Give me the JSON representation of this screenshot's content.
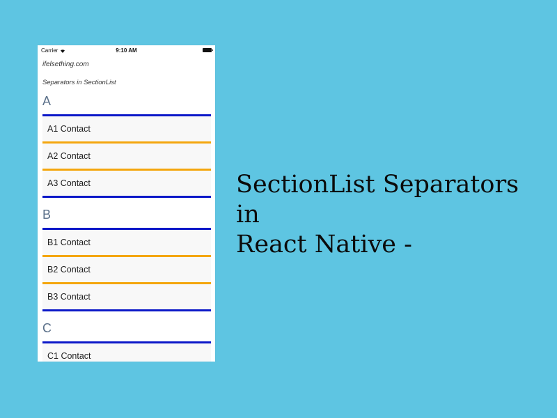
{
  "status_bar": {
    "carrier": "Carrier",
    "time": "9:10 AM"
  },
  "app": {
    "site": "ifelsething.com",
    "subtitle": "Separators in SectionList"
  },
  "sections": [
    {
      "title": "A",
      "items": [
        "A1 Contact",
        "A2 Contact",
        "A3 Contact"
      ]
    },
    {
      "title": "B",
      "items": [
        "B1 Contact",
        "B2 Contact",
        "B3 Contact"
      ]
    },
    {
      "title": "C",
      "items": [
        "C1 Contact"
      ]
    }
  ],
  "colors": {
    "section_separator": "#0c18c8",
    "item_separator": "#f4a60e",
    "background": "#5ec5e2"
  },
  "headline": {
    "line1": "SectionList Separators in",
    "line2": "React Native -"
  }
}
